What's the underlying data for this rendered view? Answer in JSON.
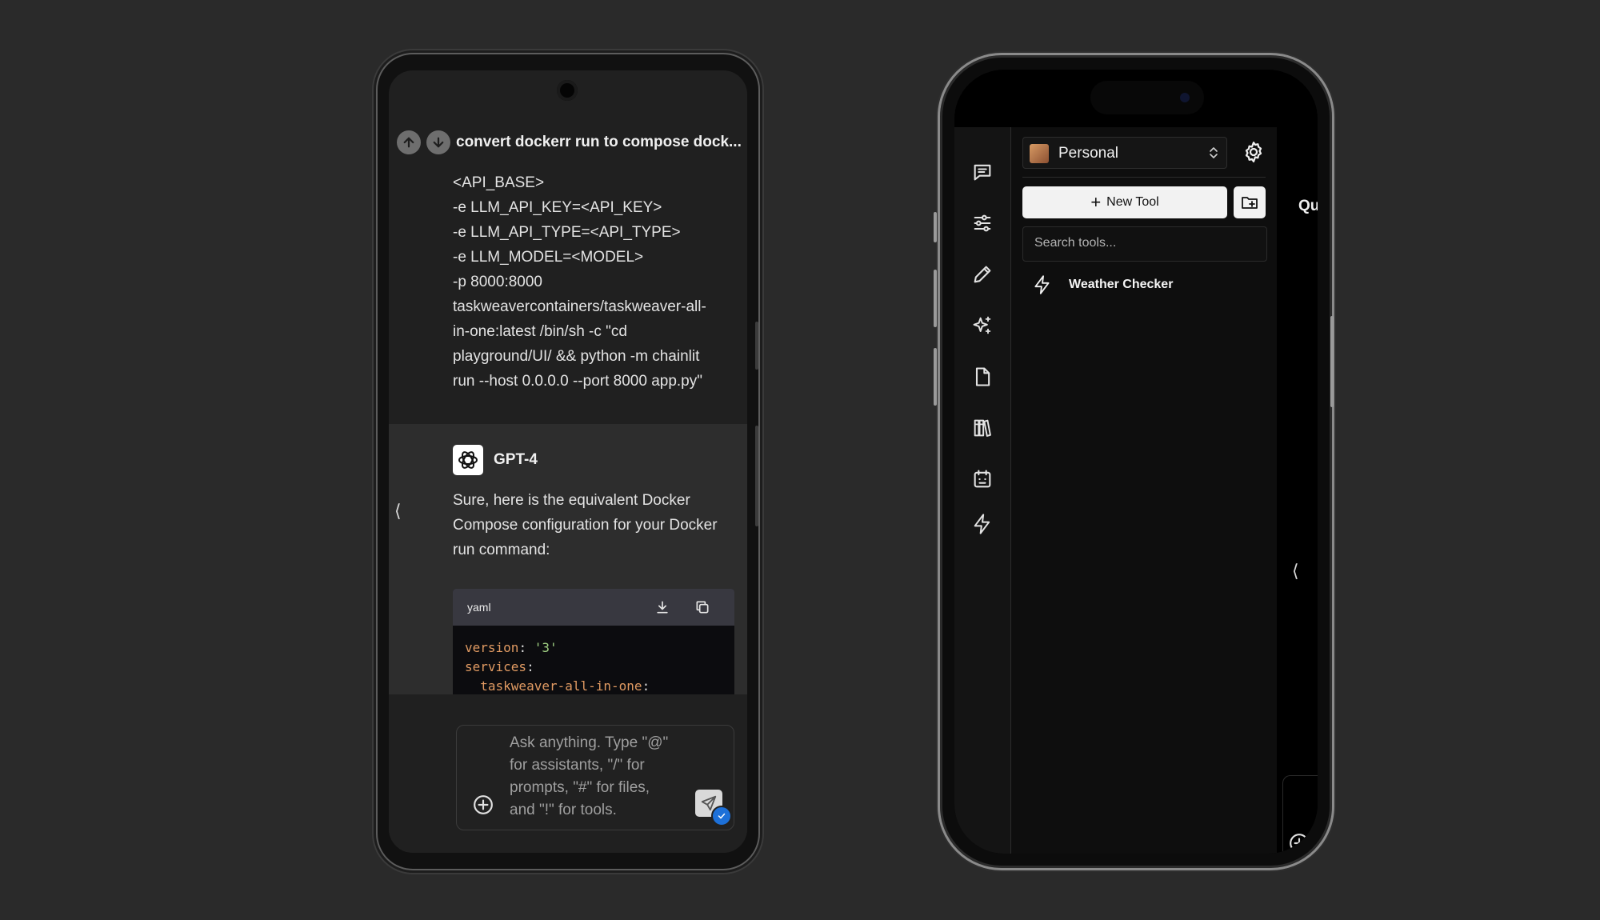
{
  "left_phone": {
    "chat_title": "convert dockerr run to compose dock...",
    "user_message_lines": [
      "<API_BASE>",
      "-e LLM_API_KEY=<API_KEY>",
      "-e LLM_API_TYPE=<API_TYPE>",
      "-e LLM_MODEL=<MODEL>",
      "-p 8000:8000",
      "taskweavercontainers/taskweaver-all-",
      "in-one:latest /bin/sh -c \"cd",
      "playground/UI/ && python -m chainlit",
      "run --host 0.0.0.0 --port 8000 app.py\""
    ],
    "assistant": {
      "name": "GPT-4",
      "message": "Sure, here is the equivalent Docker Compose configuration for your Docker run command:"
    },
    "code_block": {
      "language": "yaml",
      "lines": [
        {
          "key": "version",
          "sep": ": ",
          "str": "'3'"
        },
        {
          "key": "services",
          "sep": ":",
          "str": ""
        },
        {
          "key": "  taskweaver-all-in-one",
          "sep": ":",
          "str": ""
        }
      ]
    },
    "input_placeholder": "Ask anything. Type \"@\" for assistants, \"/\" for prompts, \"#\" for files, and \"!\" for tools.",
    "collapse_glyph": "⟨"
  },
  "right_phone": {
    "workspace_name": "Personal",
    "new_tool_label": "New Tool",
    "search_placeholder": "Search tools...",
    "tools": [
      "Weather Checker"
    ],
    "cut_off_title": "Qu",
    "collapse_glyph": "⟨",
    "rail_icons": [
      "chat-icon",
      "sliders-icon",
      "pencil-icon",
      "sparkles-icon",
      "file-icon",
      "library-icon",
      "assistant-icon",
      "bolt-icon"
    ]
  },
  "colors": {
    "background": "#2a2a2a",
    "accent_blue": "#1d70d8",
    "yaml_key": "#e09a62",
    "yaml_string": "#9fcf82"
  }
}
